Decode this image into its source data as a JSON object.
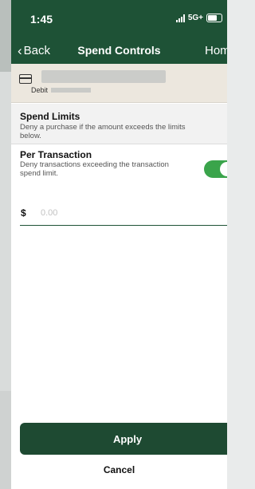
{
  "status_bar": {
    "time": "1:45",
    "network": "5G+"
  },
  "nav": {
    "back_label": "Back",
    "title": "Spend Controls",
    "home_label": "Home"
  },
  "card": {
    "type_label": "Debit"
  },
  "spend_limits": {
    "title": "Spend Limits",
    "description": "Deny a purchase if the amount exceeds the limits below."
  },
  "per_transaction": {
    "title": "Per Transaction",
    "description": "Deny transactions exceeding the transaction spend limit.",
    "enabled": true,
    "currency_symbol": "$",
    "amount_value": "",
    "amount_placeholder": "0.00"
  },
  "actions": {
    "apply_label": "Apply",
    "cancel_label": "Cancel"
  },
  "colors": {
    "header": "#1e5236",
    "accent": "#3aa44b",
    "button": "#1e4a32"
  }
}
